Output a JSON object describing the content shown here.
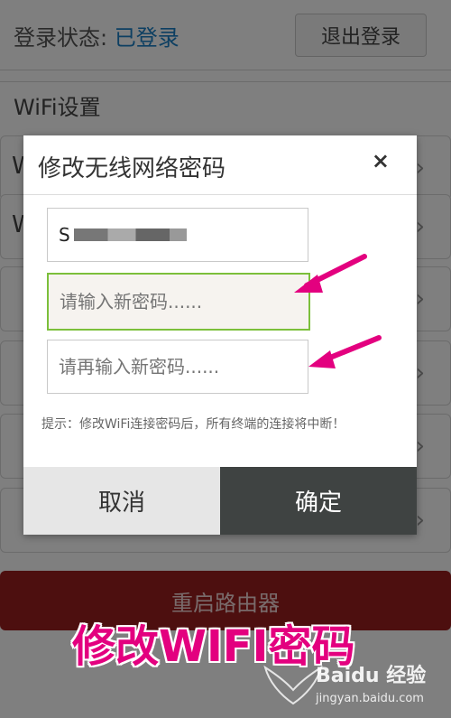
{
  "status": {
    "label": "登录状态:",
    "value": "已登录",
    "logout_label": "退出登录"
  },
  "wifi_settings": {
    "label": "WiFi设置"
  },
  "reboot": {
    "label": "重启路由器"
  },
  "dialog": {
    "title": "修改无线网络密码",
    "close_icon": "×",
    "ssid_prefix": "S",
    "new_password_placeholder": "请输入新密码......",
    "confirm_password_placeholder": "请再输入新密码......",
    "hint": "提示：修改WiFi连接密码后，所有终端的连接将中断！",
    "cancel_label": "取消",
    "ok_label": "确定"
  },
  "caption": "修改WIFI密码",
  "watermark": {
    "brand": "Baidu 经验",
    "url": "jingyan.baidu.com"
  },
  "colors": {
    "accent_blue": "#1a7fc4",
    "focus_green": "#7cbf3b",
    "reboot_red": "#9a1e1e",
    "ok_button": "#3f4342",
    "annotation_pink": "#e3007f"
  }
}
